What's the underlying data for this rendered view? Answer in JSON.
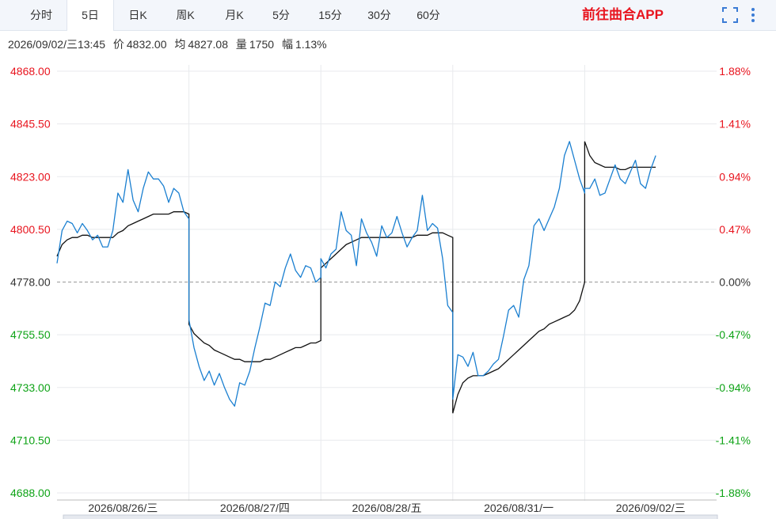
{
  "tabs": [
    {
      "label": "分时",
      "active": false
    },
    {
      "label": "5日",
      "active": true
    },
    {
      "label": "日K",
      "active": false
    },
    {
      "label": "周K",
      "active": false
    },
    {
      "label": "月K",
      "active": false
    },
    {
      "label": "5分",
      "active": false
    },
    {
      "label": "15分",
      "active": false
    },
    {
      "label": "30分",
      "active": false
    },
    {
      "label": "60分",
      "active": false
    }
  ],
  "app_link": "前往曲合APP",
  "icons": {
    "fullscreen": "fullscreen-icon",
    "more": "more-vertical-icon"
  },
  "info": {
    "datetime": "2026/09/02/三13:45",
    "price_label": "价",
    "price": "4832.00",
    "avg_label": "均",
    "avg": "4827.08",
    "volume_label": "量",
    "volume": "1750",
    "change_label": "幅",
    "change": "1.13%"
  },
  "colors": {
    "price_line": "#1a7fd0",
    "avg_line": "#111111",
    "up": "#e8141e",
    "down": "#0ea316",
    "grid": "#e8eaed"
  },
  "chart_data": {
    "type": "line",
    "base_price": 4778.0,
    "ylim": [
      4688.0,
      4868.0
    ],
    "y_ticks_left": [
      "4868.00",
      "4845.50",
      "4823.00",
      "4800.50",
      "4778.00",
      "4755.50",
      "4733.00",
      "4710.50",
      "4688.00"
    ],
    "y_ticks_right": [
      "1.88%",
      "1.41%",
      "0.94%",
      "0.47%",
      "0.00%",
      "-0.47%",
      "-0.94%",
      "-1.41%",
      "-1.88%"
    ],
    "days": [
      "2026/08/26/三",
      "2026/08/27/四",
      "2026/08/28/五",
      "2026/08/31/一",
      "2026/09/02/三"
    ],
    "series": [
      {
        "key": "price",
        "values": [
          [
            4786,
            4800,
            4804,
            4803,
            4799,
            4803,
            4800,
            4796,
            4798,
            4793,
            4793,
            4800,
            4816,
            4812,
            4826,
            4813,
            4808,
            4818,
            4825,
            4822,
            4822,
            4819,
            4812,
            4818,
            4816,
            4808,
            4805
          ],
          [
            4762,
            4750,
            4742,
            4736,
            4740,
            4734,
            4739,
            4733,
            4728,
            4725,
            4735,
            4734,
            4740,
            4750,
            4759,
            4769,
            4768,
            4778,
            4776,
            4784,
            4790,
            4783,
            4780,
            4785,
            4784,
            4778,
            4780
          ],
          [
            4788,
            4784,
            4790,
            4792,
            4808,
            4800,
            4798,
            4785,
            4805,
            4799,
            4795,
            4789,
            4802,
            4797,
            4799,
            4806,
            4799,
            4793,
            4797,
            4800,
            4815,
            4800,
            4803,
            4801,
            4788,
            4768,
            4765
          ],
          [
            4728,
            4747,
            4746,
            4742,
            4748,
            4738,
            4738,
            4740,
            4743,
            4745,
            4755,
            4766,
            4768,
            4763,
            4779,
            4785,
            4802,
            4805,
            4800,
            4805,
            4810,
            4818,
            4832,
            4838,
            4830,
            4822,
            4816
          ],
          [
            4818,
            4818,
            4822,
            4815,
            4816,
            4822,
            4828,
            4822,
            4820,
            4825,
            4830,
            4820,
            4818,
            4826,
            4832
          ]
        ]
      },
      {
        "key": "average",
        "values": [
          [
            4789,
            4794,
            4796,
            4797,
            4797,
            4798,
            4798,
            4797,
            4797,
            4797,
            4797,
            4797,
            4799,
            4800,
            4802,
            4803,
            4804,
            4805,
            4806,
            4807,
            4807,
            4807,
            4807,
            4808,
            4808,
            4808,
            4807
          ],
          [
            4760,
            4756,
            4754,
            4752,
            4751,
            4749,
            4748,
            4747,
            4746,
            4745,
            4745,
            4744,
            4744,
            4744,
            4744,
            4745,
            4745,
            4746,
            4747,
            4748,
            4749,
            4750,
            4750,
            4751,
            4752,
            4752,
            4753
          ],
          [
            4784,
            4786,
            4788,
            4790,
            4792,
            4794,
            4795,
            4796,
            4797,
            4797,
            4797,
            4797,
            4797,
            4797,
            4797,
            4797,
            4797,
            4797,
            4797,
            4798,
            4798,
            4798,
            4799,
            4799,
            4799,
            4798,
            4797
          ],
          [
            4722,
            4730,
            4735,
            4737,
            4738,
            4738,
            4738,
            4739,
            4740,
            4741,
            4743,
            4745,
            4747,
            4749,
            4751,
            4753,
            4755,
            4757,
            4758,
            4760,
            4761,
            4762,
            4763,
            4764,
            4766,
            4770,
            4778
          ],
          [
            4838,
            4832,
            4829,
            4828,
            4827,
            4827,
            4827,
            4826,
            4826,
            4827,
            4827,
            4827,
            4827,
            4827,
            4827
          ]
        ]
      }
    ]
  }
}
